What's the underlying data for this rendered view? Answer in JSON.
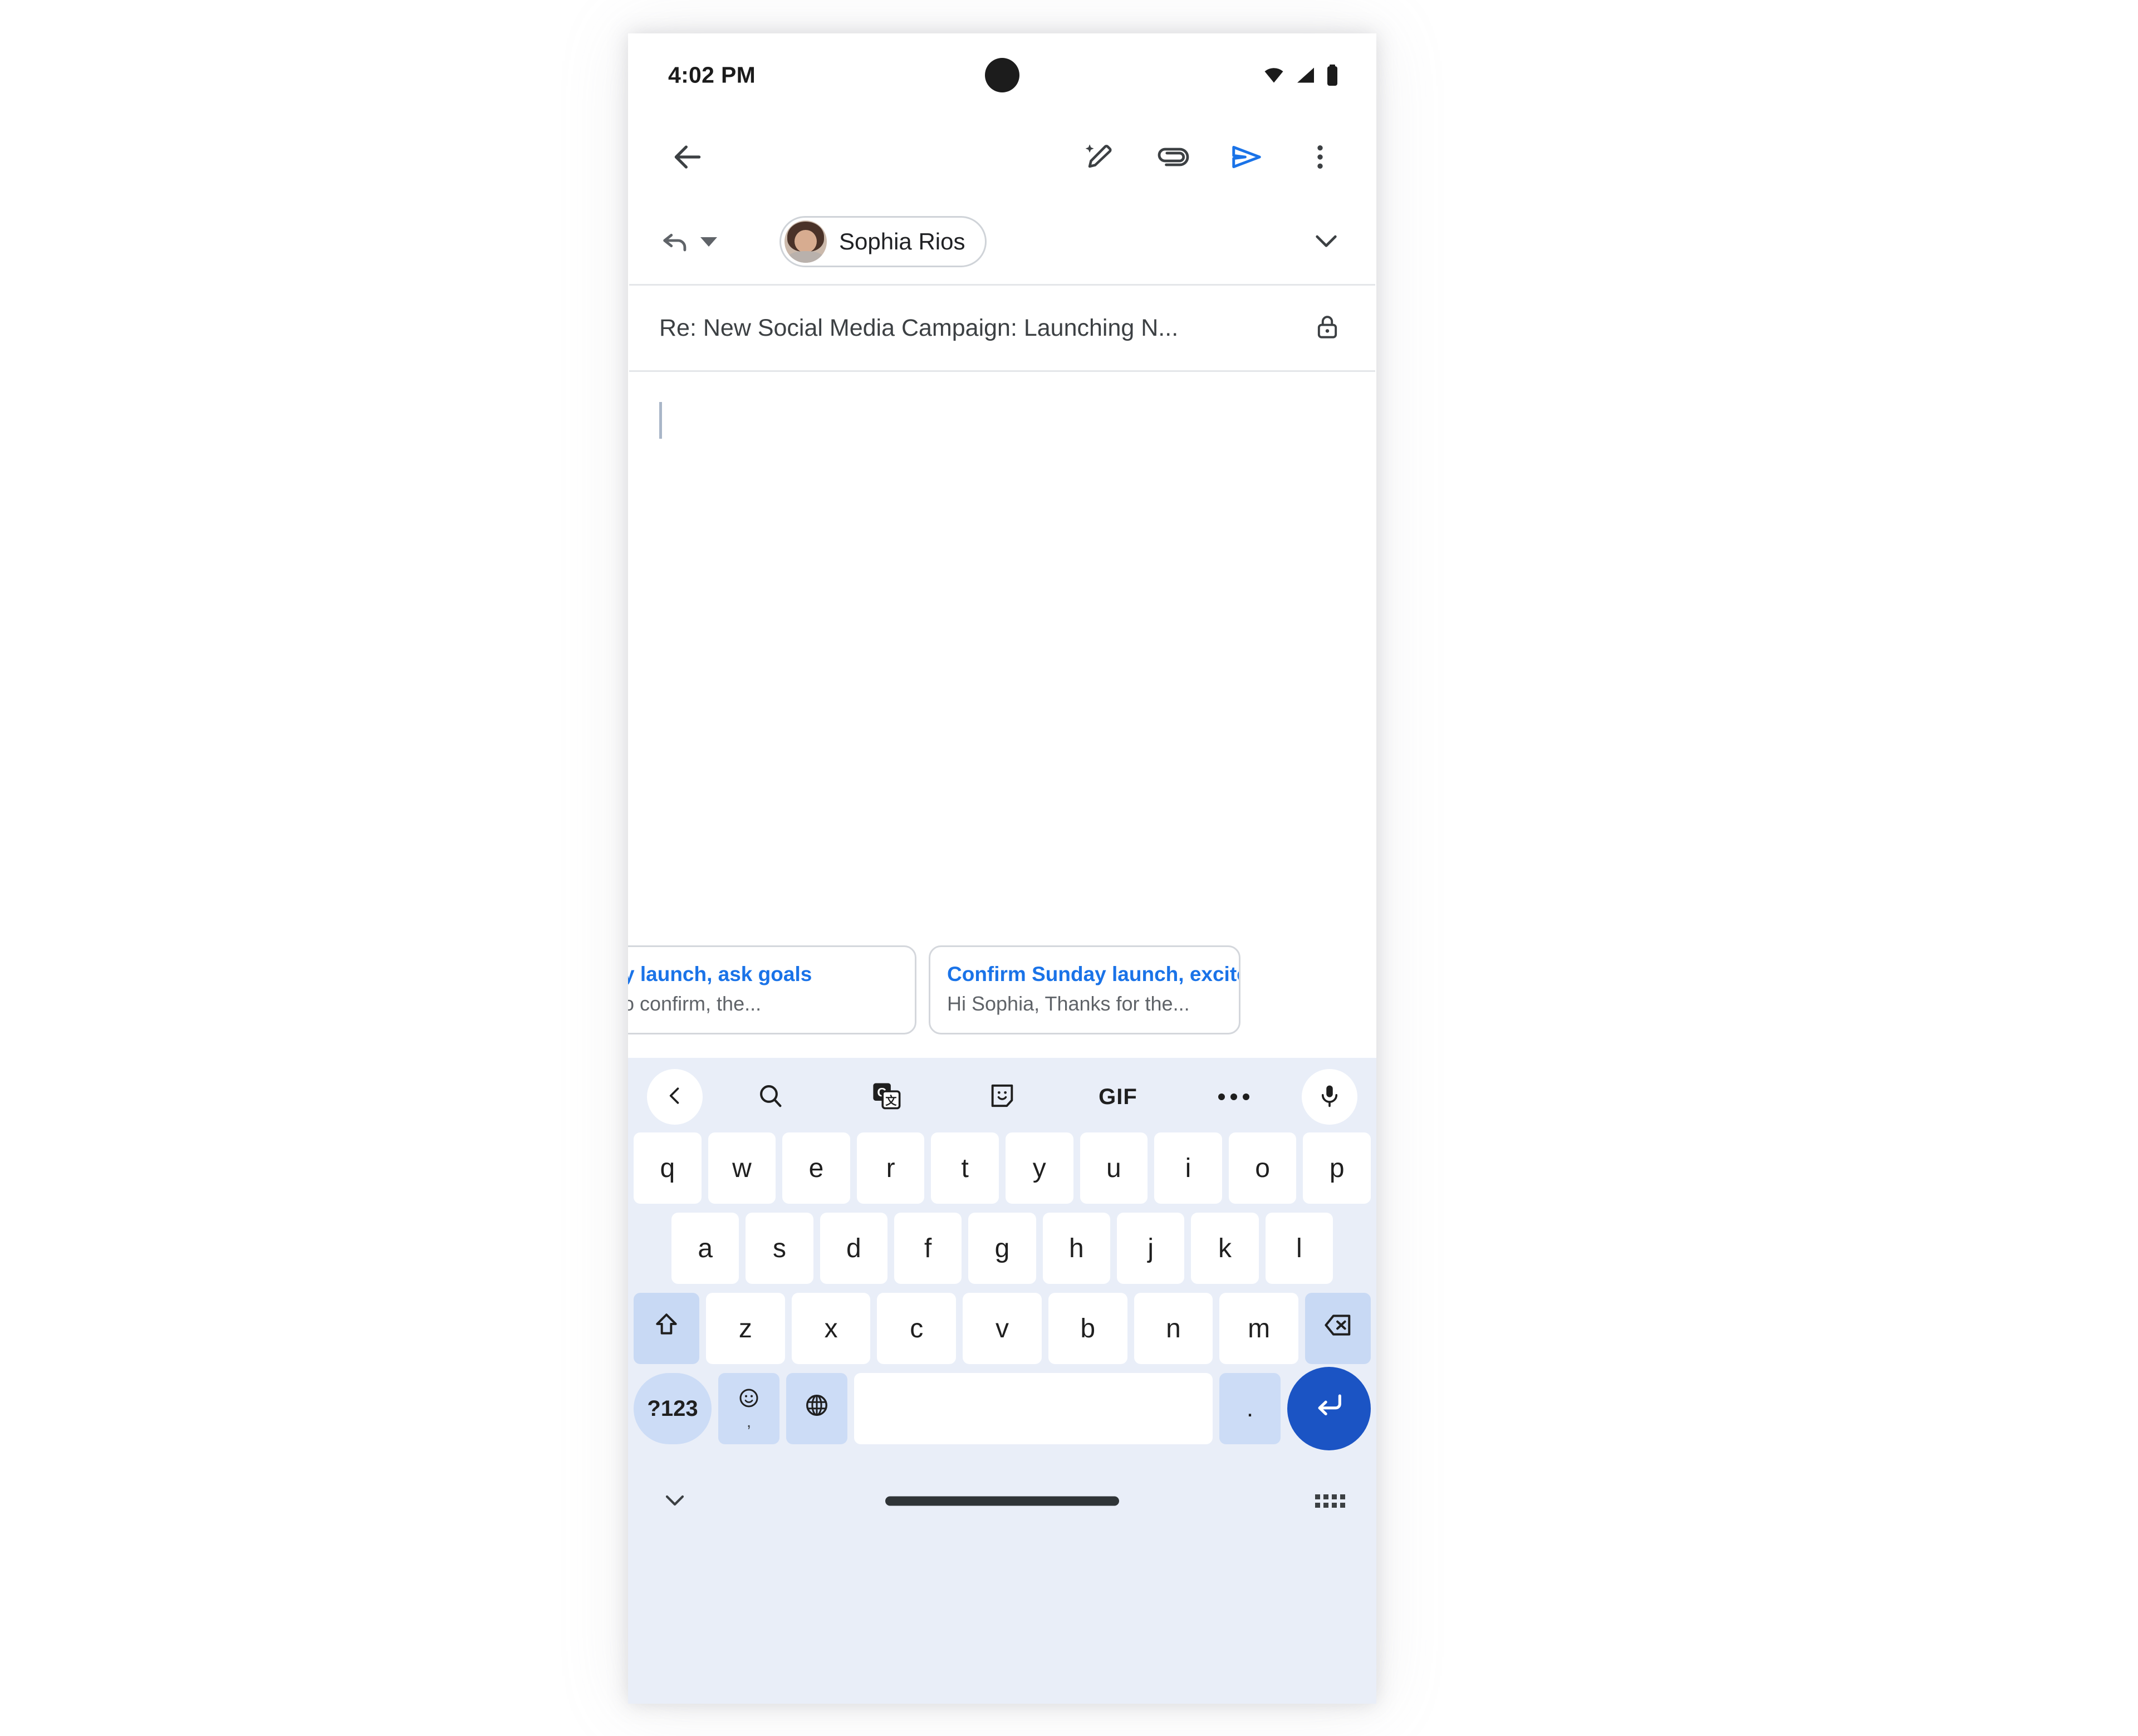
{
  "status_bar": {
    "time": "4:02 PM",
    "icons": [
      "wifi-icon",
      "cellular-signal-icon",
      "battery-icon"
    ],
    "camera": "camera-cutout"
  },
  "app_bar": {
    "back_label": "back-arrow",
    "actions": [
      {
        "name": "help-me-write-icon",
        "label": "Help me write"
      },
      {
        "name": "attach-icon",
        "label": "Attach file"
      },
      {
        "name": "send-icon",
        "label": "Send",
        "color": "#1a73e8"
      },
      {
        "name": "more-options-icon",
        "label": "More options"
      }
    ]
  },
  "recipient": {
    "reply_mode_label": "Reply",
    "chip_name": "Sophia Rios",
    "expand_label": "Expand recipients"
  },
  "subject": {
    "value": "Re: New Social Media Campaign: Launching N...",
    "encryption_label": "encryption-lock"
  },
  "body": {
    "value": "",
    "caret_color": "#a9b6c8"
  },
  "smart_replies": {
    "cards": [
      {
        "title": "y launch, ask goals",
        "subtitle": "o confirm, the..."
      },
      {
        "title": "Confirm Sunday launch, excited.",
        "subtitle": "Hi Sophia, Thanks for the..."
      }
    ],
    "accent_color": "#1a73e8"
  },
  "keyboard": {
    "toolbar": [
      {
        "name": "expand-toolbar-icon",
        "label": "<"
      },
      {
        "name": "search-icon",
        "label": "Search"
      },
      {
        "name": "translate-icon",
        "label": "Translate"
      },
      {
        "name": "sticker-icon",
        "label": "Stickers"
      },
      {
        "name": "gif-icon",
        "label": "GIF"
      },
      {
        "name": "more-icon",
        "label": "More"
      },
      {
        "name": "mic-icon",
        "label": "Voice input"
      }
    ],
    "row1": [
      "q",
      "w",
      "e",
      "r",
      "t",
      "y",
      "u",
      "i",
      "o",
      "p"
    ],
    "row2": [
      "a",
      "s",
      "d",
      "f",
      "g",
      "h",
      "j",
      "k",
      "l"
    ],
    "row3": [
      "z",
      "x",
      "c",
      "v",
      "b",
      "n",
      "m"
    ],
    "shift_label": "shift-icon",
    "backspace_label": "backspace-icon",
    "symbols_label": "?123",
    "emoji_label": "emoji-icon",
    "emoji_sub": ",",
    "globe_label": "language-globe-icon",
    "space_label": "",
    "period_label": ".",
    "enter_label": "enter-icon",
    "enter_color": "#1b54c4",
    "key_bg": "#ffffff",
    "fn_key_bg": "#c8d9f4",
    "background": "#e9eef8"
  },
  "nav_bar": {
    "hide_keyboard_label": "hide-keyboard-icon",
    "gesture_pill_label": "gesture-nav-pill",
    "switch_keyboard_label": "switch-keyboard-icon"
  }
}
